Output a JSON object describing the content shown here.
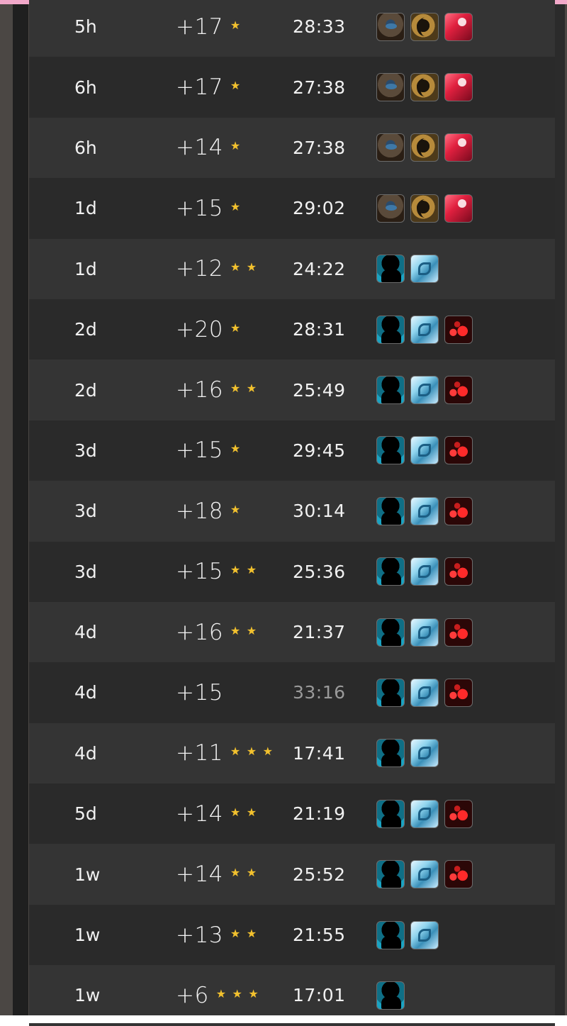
{
  "rows": [
    {
      "time": "5h",
      "level": "+17",
      "stars": 1,
      "duration": "28:33",
      "duration_dim": false,
      "affixes": [
        "hooded-figure-icon",
        "crescent-icon",
        "red-swirl-icon"
      ]
    },
    {
      "time": "6h",
      "level": "+17",
      "stars": 1,
      "duration": "27:38",
      "duration_dim": false,
      "affixes": [
        "hooded-figure-icon",
        "crescent-icon",
        "red-swirl-icon"
      ]
    },
    {
      "time": "6h",
      "level": "+14",
      "stars": 1,
      "duration": "27:38",
      "duration_dim": false,
      "affixes": [
        "hooded-figure-icon",
        "crescent-icon",
        "red-swirl-icon"
      ]
    },
    {
      "time": "1d",
      "level": "+15",
      "stars": 1,
      "duration": "29:02",
      "duration_dim": false,
      "affixes": [
        "hooded-figure-icon",
        "crescent-icon",
        "red-swirl-icon"
      ]
    },
    {
      "time": "1d",
      "level": "+12",
      "stars": 2,
      "duration": "24:22",
      "duration_dim": false,
      "affixes": [
        "silhouette-icon",
        "ice-dragon-icon"
      ]
    },
    {
      "time": "2d",
      "level": "+20",
      "stars": 1,
      "duration": "28:31",
      "duration_dim": false,
      "affixes": [
        "silhouette-icon",
        "ice-dragon-icon",
        "red-orbs-icon"
      ]
    },
    {
      "time": "2d",
      "level": "+16",
      "stars": 2,
      "duration": "25:49",
      "duration_dim": false,
      "affixes": [
        "silhouette-icon",
        "ice-dragon-icon",
        "red-orbs-icon"
      ]
    },
    {
      "time": "3d",
      "level": "+15",
      "stars": 1,
      "duration": "29:45",
      "duration_dim": false,
      "affixes": [
        "silhouette-icon",
        "ice-dragon-icon",
        "red-orbs-icon"
      ]
    },
    {
      "time": "3d",
      "level": "+18",
      "stars": 1,
      "duration": "30:14",
      "duration_dim": false,
      "affixes": [
        "silhouette-icon",
        "ice-dragon-icon",
        "red-orbs-icon"
      ]
    },
    {
      "time": "3d",
      "level": "+15",
      "stars": 2,
      "duration": "25:36",
      "duration_dim": false,
      "affixes": [
        "silhouette-icon",
        "ice-dragon-icon",
        "red-orbs-icon"
      ]
    },
    {
      "time": "4d",
      "level": "+16",
      "stars": 2,
      "duration": "21:37",
      "duration_dim": false,
      "affixes": [
        "silhouette-icon",
        "ice-dragon-icon",
        "red-orbs-icon"
      ]
    },
    {
      "time": "4d",
      "level": "+15",
      "stars": 0,
      "duration": "33:16",
      "duration_dim": true,
      "affixes": [
        "silhouette-icon",
        "ice-dragon-icon",
        "red-orbs-icon"
      ]
    },
    {
      "time": "4d",
      "level": "+11",
      "stars": 3,
      "duration": "17:41",
      "duration_dim": false,
      "affixes": [
        "silhouette-icon",
        "ice-dragon-icon"
      ]
    },
    {
      "time": "5d",
      "level": "+14",
      "stars": 2,
      "duration": "21:19",
      "duration_dim": false,
      "affixes": [
        "silhouette-icon",
        "ice-dragon-icon",
        "red-orbs-icon"
      ]
    },
    {
      "time": "1w",
      "level": "+14",
      "stars": 2,
      "duration": "25:52",
      "duration_dim": false,
      "affixes": [
        "silhouette-icon",
        "ice-dragon-icon",
        "red-orbs-icon"
      ]
    },
    {
      "time": "1w",
      "level": "+13",
      "stars": 2,
      "duration": "21:55",
      "duration_dim": false,
      "affixes": [
        "silhouette-icon",
        "ice-dragon-icon"
      ]
    },
    {
      "time": "1w",
      "level": "+6",
      "stars": 3,
      "duration": "17:01",
      "duration_dim": false,
      "affixes": [
        "silhouette-icon"
      ]
    }
  ],
  "colors": {
    "star": "#f2c12e",
    "text": "#f1f1f1",
    "dim_text": "#9a9a9a"
  }
}
